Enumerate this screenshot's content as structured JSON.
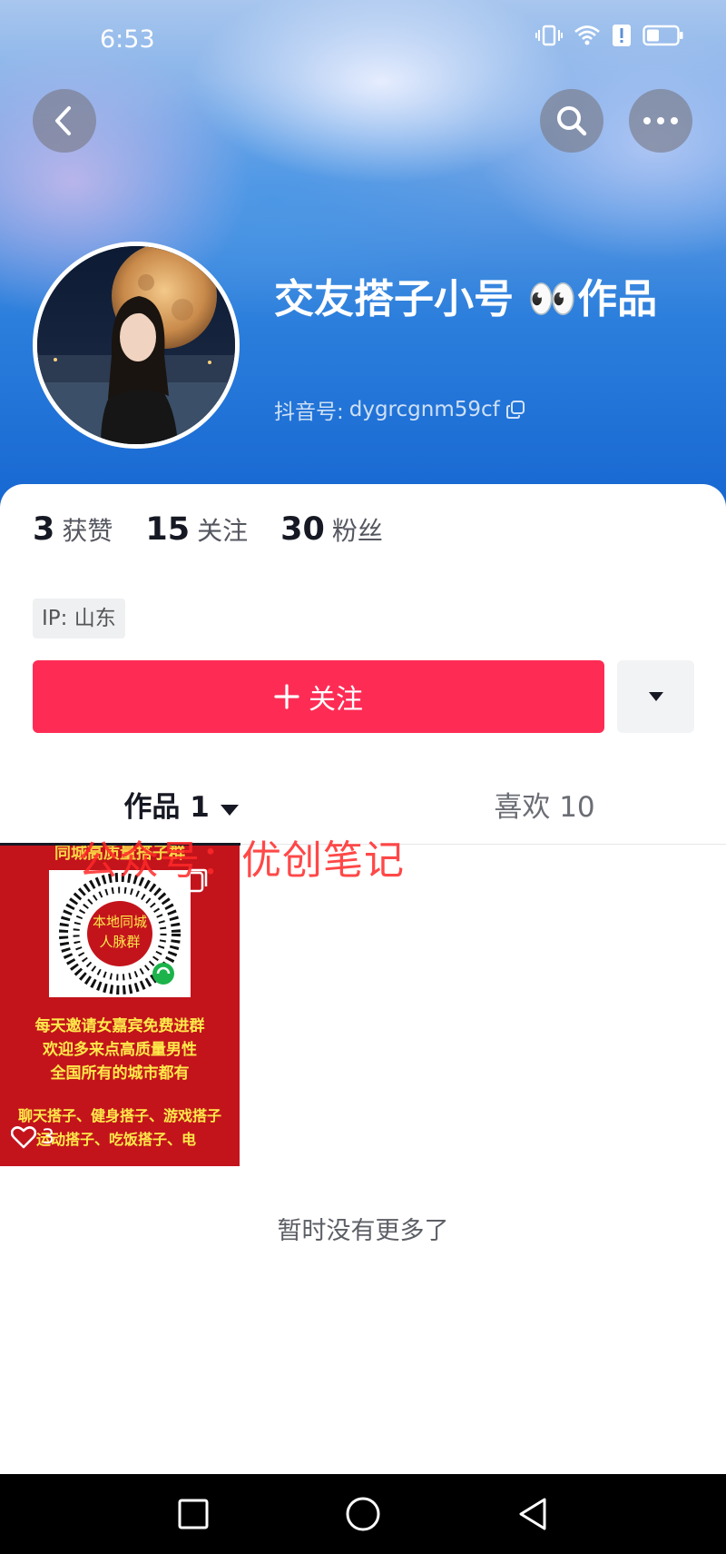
{
  "status_bar": {
    "time": "6:53"
  },
  "profile": {
    "nickname": "交友搭子小号 👀作品",
    "douyin_id_label": "抖音号:",
    "douyin_id": "dygrcgnm59cf",
    "ip_label": "IP:",
    "ip_location": "山东"
  },
  "stats": [
    {
      "value": "3",
      "label": "获赞"
    },
    {
      "value": "15",
      "label": "关注"
    },
    {
      "value": "30",
      "label": "粉丝"
    }
  ],
  "follow_button": {
    "label": "关注"
  },
  "tabs": [
    {
      "label": "作品 1",
      "selected": true
    },
    {
      "label": "喜欢 10",
      "selected": false
    }
  ],
  "videos": [
    {
      "qr_center_text": [
        "本地同城",
        "人脉群"
      ],
      "header_text": "同城高质量搭子群",
      "lines": [
        "每天邀请女嘉宾免费进群",
        "欢迎多来点高质量男性",
        "全国所有的城市都有"
      ],
      "tags_lines": [
        "聊天搭子、健身搭子、游戏搭子",
        "运动搭子、吃饭搭子、电"
      ],
      "likes": "3"
    }
  ],
  "watermark": "公众号：优创笔记",
  "empty_hint": "暂时没有更多了",
  "colors": {
    "accent": "#fe2c55",
    "hero_blue": "#1767d2"
  },
  "icons": [
    "back-arrow-icon",
    "search-icon",
    "more-icon",
    "copy-icon",
    "plus-icon",
    "triangle-down-icon",
    "heart-icon",
    "recent-apps-icon",
    "home-icon",
    "back-nav-icon"
  ]
}
